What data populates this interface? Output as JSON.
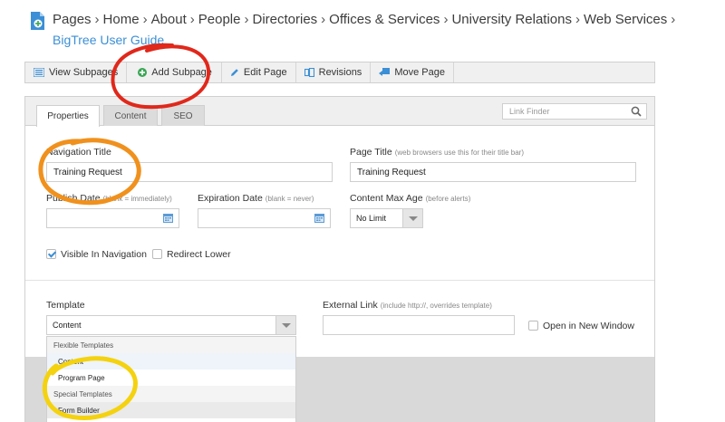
{
  "breadcrumb": {
    "items": [
      "Pages",
      "Home",
      "About",
      "People",
      "Directories",
      "Offices & Services",
      "University Relations",
      "Web Services"
    ],
    "separator": "›",
    "current": "BigTree User Guide"
  },
  "toolbar": {
    "view_subpages": "View Subpages",
    "add_subpage": "Add Subpage",
    "edit_page": "Edit Page",
    "revisions": "Revisions",
    "move_page": "Move Page"
  },
  "tabs": [
    "Properties",
    "Content",
    "SEO"
  ],
  "link_finder": {
    "placeholder": "Link Finder"
  },
  "form": {
    "nav_title": {
      "label": "Navigation Title",
      "value": "Training Request"
    },
    "page_title": {
      "label": "Page Title",
      "hint": "(web browsers use this for their title bar)",
      "value": "Training Request"
    },
    "publish_date": {
      "label": "Publish Date",
      "hint": "(blank = immediately)"
    },
    "expiration_date": {
      "label": "Expiration Date",
      "hint": "(blank = never)"
    },
    "content_max_age": {
      "label": "Content Max Age",
      "hint": "(before alerts)",
      "value": "No Limit"
    },
    "visible_in_nav": {
      "label": "Visible In Navigation",
      "checked": true
    },
    "redirect_lower": {
      "label": "Redirect Lower",
      "checked": false
    },
    "template": {
      "label": "Template",
      "value": "Content"
    },
    "external_link": {
      "label": "External Link",
      "hint": "(include http://, overrides template)"
    },
    "open_new_window": {
      "label": "Open in New Window",
      "checked": false
    }
  },
  "template_dropdown": {
    "groups": [
      {
        "label": "Flexible Templates",
        "items": [
          "Content",
          "Program Page"
        ]
      },
      {
        "label": "Special Templates",
        "items": [
          "Form Builder"
        ]
      }
    ]
  },
  "colors": {
    "link_blue": "#3b8fd6",
    "annotation_red": "#e0281b",
    "annotation_orange": "#f0911d",
    "annotation_yellow": "#f4d20f",
    "add_icon_green": "#3aa655"
  }
}
